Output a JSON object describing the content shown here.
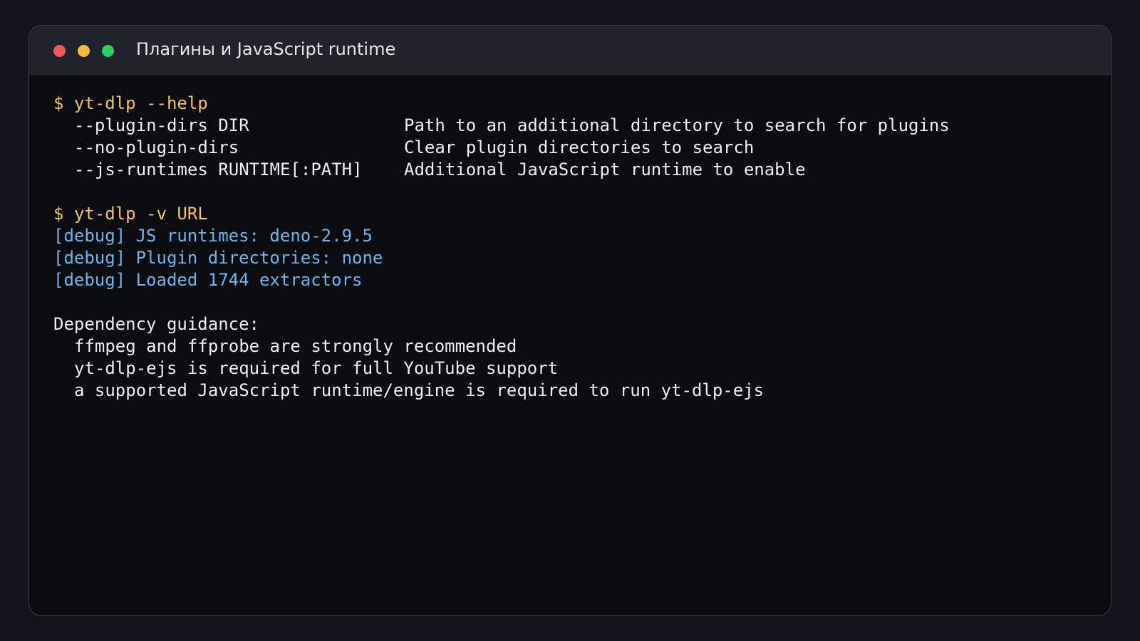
{
  "window": {
    "title": "Плагины и JavaScript runtime",
    "controls": {
      "close_color": "#ef5a5a",
      "minimize_color": "#f5b93d",
      "maximize_color": "#2fcb63"
    }
  },
  "terminal": {
    "help_command": "$ yt-dlp --help",
    "help_options": [
      {
        "flag": "--plugin-dirs DIR",
        "desc": "Path to an additional directory to search for plugins"
      },
      {
        "flag": "--no-plugin-dirs",
        "desc": "Clear plugin directories to search"
      },
      {
        "flag": "--js-runtimes RUNTIME[:PATH]",
        "desc": "Additional JavaScript runtime to enable"
      }
    ],
    "verbose_command": "$ yt-dlp -v URL",
    "debug_lines": [
      "[debug] JS runtimes: deno-2.9.5",
      "[debug] Plugin directories: none",
      "[debug] Loaded 1744 extractors"
    ],
    "guidance_header": "Dependency guidance:",
    "guidance_lines": [
      "ffmpeg and ffprobe are strongly recommended",
      "yt-dlp-ejs is required for full YouTube support",
      "a supported JavaScript runtime/engine is required to run yt-dlp-ejs"
    ]
  },
  "colors": {
    "prompt": "#f5c35f",
    "debug": "#6cb6ee",
    "text": "#eceef1"
  }
}
